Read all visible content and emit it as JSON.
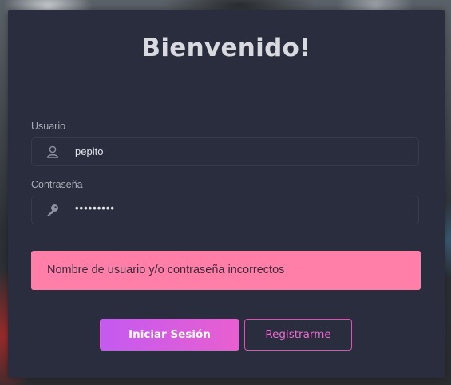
{
  "login": {
    "title": "Bienvenido!",
    "username": {
      "label": "Usuario",
      "value": "pepito",
      "icon": "user-icon"
    },
    "password": {
      "label": "Contraseña",
      "value": "•••••••••",
      "icon": "key-icon"
    },
    "error_message": "Nombre de usuario y/o contraseña incorrectos",
    "login_button_label": "Iniciar Sesión",
    "register_button_label": "Registrarme"
  },
  "colors": {
    "card_background": "#2a2d3e",
    "error_background": "#ff7fa8",
    "accent_gradient_start": "#c45af0",
    "accent_gradient_end": "#e85fd0",
    "register_border": "#e050b8"
  }
}
